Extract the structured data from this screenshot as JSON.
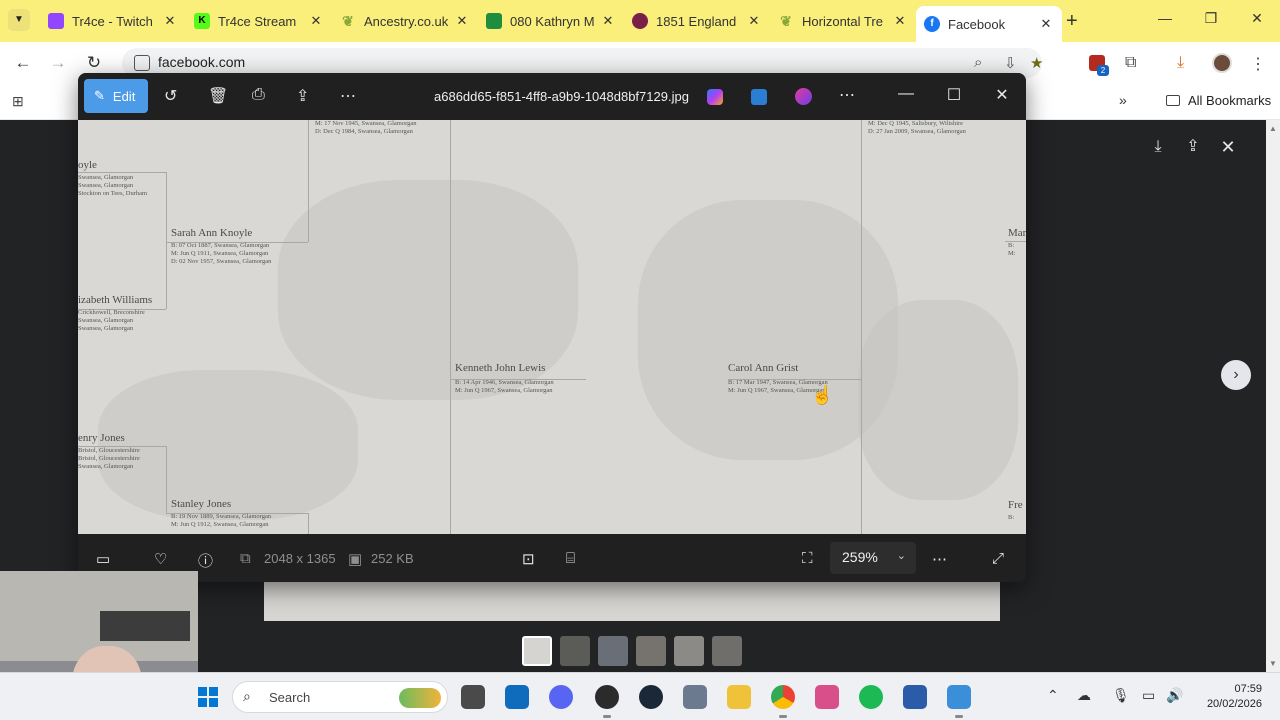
{
  "browser": {
    "tabs": [
      {
        "title": "Tr4ce - Twitch",
        "icon": "twitch-icon",
        "color": "#9146ff"
      },
      {
        "title": "Tr4ce Stream",
        "icon": "kick-icon",
        "color": "#53fc18"
      },
      {
        "title": "Ancestry.co.uk",
        "icon": "ancestry-leaf-icon",
        "color": "#8aa83a"
      },
      {
        "title": "080 Kathryn M",
        "icon": "sheets-icon",
        "color": "#1e8e3e"
      },
      {
        "title": "1851 England",
        "icon": "findmypast-icon",
        "color": "#7a1f4a"
      },
      {
        "title": "Horizontal Tre",
        "icon": "ancestry-leaf-icon",
        "color": "#8aa83a"
      },
      {
        "title": "Facebook",
        "icon": "facebook-icon",
        "color": "#1877f2"
      }
    ],
    "url": "facebook.com",
    "bookmarks_folder": "All Bookmarks"
  },
  "photos_app": {
    "edit_label": "Edit",
    "filename": "a686dd65-f851-4ff8-a9b9-1048d8bf7129.jpg",
    "dimensions": "2048 x 1365",
    "filesize": "252 KB",
    "zoom": "259%"
  },
  "family_tree": {
    "people": [
      {
        "name": "",
        "details": [
          "M: 17 Nov 1945, Swansea, Glamorgan",
          "D: Dec Q 1984, Swansea, Glamorgan"
        ]
      },
      {
        "name": "",
        "details": [
          "M: Dec Q 1945, Salisbury, Wiltshire",
          "D: 27 Jan 2009, Swansea, Glamorgan"
        ]
      },
      {
        "name": "oyle",
        "details": [
          "Swansea, Glamorgan",
          "Swansea, Glamorgan",
          "Stockton on Tees, Durham"
        ]
      },
      {
        "name": "Sarah Ann Knoyle",
        "details": [
          "B: 07 Oct 1887, Swansea, Glamorgan",
          "M: Jun Q 1911, Swansea, Glamorgan",
          "D: 02 Nov 1957, Swansea, Glamorgan"
        ]
      },
      {
        "name": "Mar",
        "details": [
          "B:",
          "M:"
        ]
      },
      {
        "name": "izabeth Williams",
        "details": [
          "Crickhowell, Breconshire",
          "Swansea, Glamorgan",
          "Swansea, Glamorgan"
        ]
      },
      {
        "name": "Kenneth John Lewis",
        "details": [
          "B: 14 Apr 1946, Swansea, Glamorgan",
          "M: Jun Q 1967, Swansea, Glamorgan"
        ]
      },
      {
        "name": "Carol Ann Grist",
        "details": [
          "B: 17 Mar 1947, Swansea, Glamorgan",
          "M: Jun Q 1967, Swansea, Glamorgan"
        ]
      },
      {
        "name": "enry Jones",
        "details": [
          "Bristol, Gloucestershire",
          "Bristol, Gloucestershire",
          "Swansea, Glamorgan"
        ]
      },
      {
        "name": "Stanley Jones",
        "details": [
          "B: 19 Nov 1889, Swansea, Glamorgan",
          "M: Jun Q 1912, Swansea, Glamorgan"
        ]
      },
      {
        "name": "Fre",
        "details": [
          "B:"
        ]
      }
    ]
  },
  "taskbar": {
    "search_label": "Search",
    "time": "07:59",
    "date": "20/02/2026"
  }
}
